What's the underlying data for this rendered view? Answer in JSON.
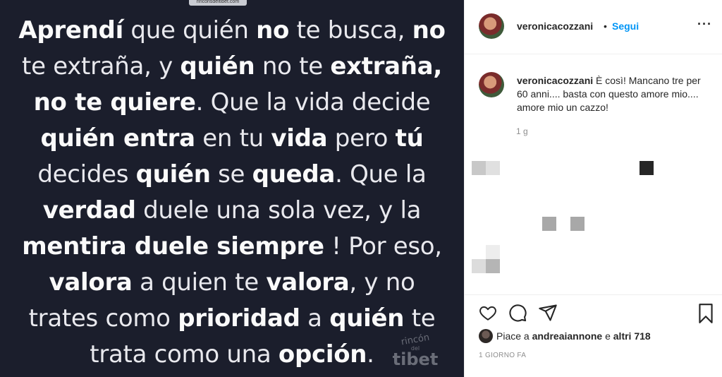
{
  "post": {
    "watermark_top": "rinconsdeltibet.com",
    "quote_lines": [
      [
        {
          "t": "Aprendí",
          "b": true
        },
        {
          "t": " que quién ",
          "b": false
        },
        {
          "t": "no",
          "b": true
        },
        {
          "t": " te busca, ",
          "b": false
        },
        {
          "t": "no",
          "b": true
        }
      ],
      [
        {
          "t": "te extraña, y ",
          "b": false
        },
        {
          "t": "quién",
          "b": true
        },
        {
          "t": " no te ",
          "b": false
        },
        {
          "t": "extraña,",
          "b": true
        }
      ],
      [
        {
          "t": "no te quiere",
          "b": true
        },
        {
          "t": ". Que la vida decide",
          "b": false
        }
      ],
      [
        {
          "t": "quién entra",
          "b": true
        },
        {
          "t": " en tu ",
          "b": false
        },
        {
          "t": "vida",
          "b": true
        },
        {
          "t": " pero ",
          "b": false
        },
        {
          "t": "tú",
          "b": true
        }
      ],
      [
        {
          "t": "decides ",
          "b": false
        },
        {
          "t": "quién",
          "b": true
        },
        {
          "t": " se ",
          "b": false
        },
        {
          "t": "queda",
          "b": true
        },
        {
          "t": ". Que la",
          "b": false
        }
      ],
      [
        {
          "t": "verdad",
          "b": true
        },
        {
          "t": " duele una sola vez, y la",
          "b": false
        }
      ],
      [
        {
          "t": "mentira duele siempre",
          "b": true
        },
        {
          "t": " ! Por eso,",
          "b": false
        }
      ],
      [
        {
          "t": "valora",
          "b": true
        },
        {
          "t": " a quien te ",
          "b": false
        },
        {
          "t": "valora",
          "b": true
        },
        {
          "t": ", y no",
          "b": false
        }
      ],
      [
        {
          "t": "trates como ",
          "b": false
        },
        {
          "t": "prioridad",
          "b": true
        },
        {
          "t": " a ",
          "b": false
        },
        {
          "t": "quién",
          "b": true
        },
        {
          "t": " te",
          "b": false
        }
      ],
      [
        {
          "t": "trata como una ",
          "b": false
        },
        {
          "t": "opción",
          "b": true
        },
        {
          "t": ".",
          "b": false
        }
      ]
    ],
    "watermark_bottom": {
      "line1": "rincón",
      "line2": "del",
      "line3": "tibet"
    }
  },
  "header": {
    "username": "veronicacozzani",
    "separator": "•",
    "follow_label": "Segui",
    "more_label": "···"
  },
  "caption": {
    "username": "veronicacozzani",
    "text": " È così! Mancano tre per 60 anni.... basta con questo amore mio.... amore mio un cazzo!",
    "time": "1 g"
  },
  "likes": {
    "prefix": "Piace a ",
    "user": "andreaiannone",
    "middle": " e ",
    "others": "altri 718"
  },
  "date": "1 GIORNO FA",
  "icons": {
    "like": "heart-icon",
    "comment": "comment-icon",
    "share": "share-icon",
    "save": "bookmark-icon"
  },
  "colors": {
    "accent": "#0095f6",
    "post_bg": "#1b1e2c",
    "text_primary": "#262626",
    "text_secondary": "#8e8e8e"
  }
}
